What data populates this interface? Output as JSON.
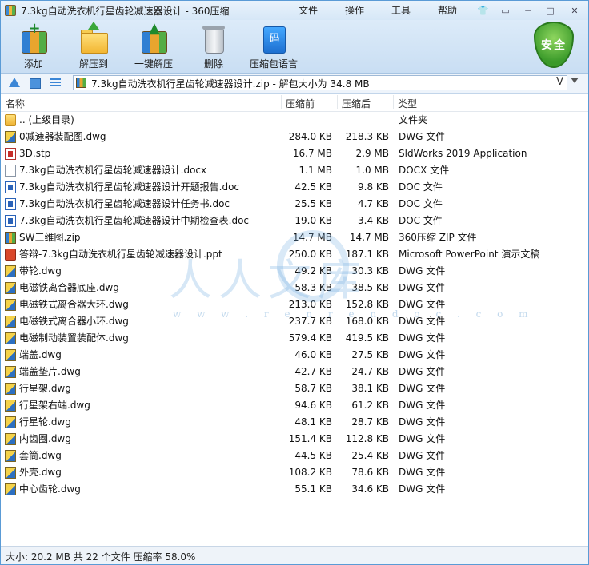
{
  "window": {
    "title": "7.3kg自动洗衣机行星齿轮减速器设计 - 360压缩",
    "controls": [
      "shirt-icon",
      "menu-icon",
      "minimize-icon",
      "maximize-icon",
      "close-icon"
    ]
  },
  "menu": [
    "文件",
    "操作",
    "工具",
    "帮助"
  ],
  "toolbar": {
    "add": "添加",
    "extract_to": "解压到",
    "one_click_extract": "一键解压",
    "delete": "删除",
    "language": "压缩包语言",
    "language_badge": "码",
    "security": "安全"
  },
  "address": {
    "text": "7.3kg自动洗衣机行星齿轮减速器设计.zip - 解包大小为 34.8 MB",
    "v_label": "V"
  },
  "columns": {
    "name": "名称",
    "original": "压缩前",
    "compressed": "压缩后",
    "type": "类型"
  },
  "files": [
    {
      "name": ".. (上级目录)",
      "size": "",
      "compressed": "",
      "type": "文件夹",
      "icon": "folder"
    },
    {
      "name": "0减速器装配图.dwg",
      "size": "284.0 KB",
      "compressed": "218.3 KB",
      "type": "DWG 文件",
      "icon": "dwg"
    },
    {
      "name": "3D.stp",
      "size": "16.7 MB",
      "compressed": "2.9 MB",
      "type": "SldWorks 2019 Application",
      "icon": "stp"
    },
    {
      "name": "7.3kg自动洗衣机行星齿轮减速器设计.docx",
      "size": "1.1 MB",
      "compressed": "1.0 MB",
      "type": "DOCX 文件",
      "icon": "docx"
    },
    {
      "name": "7.3kg自动洗衣机行星齿轮减速器设计开题报告.doc",
      "size": "42.5 KB",
      "compressed": "9.8 KB",
      "type": "DOC 文件",
      "icon": "doc"
    },
    {
      "name": "7.3kg自动洗衣机行星齿轮减速器设计任务书.doc",
      "size": "25.5 KB",
      "compressed": "4.7 KB",
      "type": "DOC 文件",
      "icon": "doc"
    },
    {
      "name": "7.3kg自动洗衣机行星齿轮减速器设计中期检查表.doc",
      "size": "19.0 KB",
      "compressed": "3.4 KB",
      "type": "DOC 文件",
      "icon": "doc"
    },
    {
      "name": "SW三维图.zip",
      "size": "14.7 MB",
      "compressed": "14.7 MB",
      "type": "360压缩 ZIP 文件",
      "icon": "zip"
    },
    {
      "name": "答辩-7.3kg自动洗衣机行星齿轮减速器设计.ppt",
      "size": "250.0 KB",
      "compressed": "187.1 KB",
      "type": "Microsoft PowerPoint 演示文稿",
      "icon": "ppt"
    },
    {
      "name": "带轮.dwg",
      "size": "49.2 KB",
      "compressed": "30.3 KB",
      "type": "DWG 文件",
      "icon": "dwg"
    },
    {
      "name": "电磁铁离合器底座.dwg",
      "size": "58.3 KB",
      "compressed": "38.5 KB",
      "type": "DWG 文件",
      "icon": "dwg"
    },
    {
      "name": "电磁铁式离合器大环.dwg",
      "size": "213.0 KB",
      "compressed": "152.8 KB",
      "type": "DWG 文件",
      "icon": "dwg"
    },
    {
      "name": "电磁铁式离合器小环.dwg",
      "size": "237.7 KB",
      "compressed": "168.0 KB",
      "type": "DWG 文件",
      "icon": "dwg"
    },
    {
      "name": "电磁制动装置装配体.dwg",
      "size": "579.4 KB",
      "compressed": "419.5 KB",
      "type": "DWG 文件",
      "icon": "dwg"
    },
    {
      "name": "端盖.dwg",
      "size": "46.0 KB",
      "compressed": "27.5 KB",
      "type": "DWG 文件",
      "icon": "dwg"
    },
    {
      "name": "端盖垫片.dwg",
      "size": "42.7 KB",
      "compressed": "24.7 KB",
      "type": "DWG 文件",
      "icon": "dwg"
    },
    {
      "name": "行星架.dwg",
      "size": "58.7 KB",
      "compressed": "38.1 KB",
      "type": "DWG 文件",
      "icon": "dwg"
    },
    {
      "name": "行星架右端.dwg",
      "size": "94.6 KB",
      "compressed": "61.2 KB",
      "type": "DWG 文件",
      "icon": "dwg"
    },
    {
      "name": "行星轮.dwg",
      "size": "48.1 KB",
      "compressed": "28.7 KB",
      "type": "DWG 文件",
      "icon": "dwg"
    },
    {
      "name": "内齿圈.dwg",
      "size": "151.4 KB",
      "compressed": "112.8 KB",
      "type": "DWG 文件",
      "icon": "dwg"
    },
    {
      "name": "套筒.dwg",
      "size": "44.5 KB",
      "compressed": "25.4 KB",
      "type": "DWG 文件",
      "icon": "dwg"
    },
    {
      "name": "外壳.dwg",
      "size": "108.2 KB",
      "compressed": "78.6 KB",
      "type": "DWG 文件",
      "icon": "dwg"
    },
    {
      "name": "中心齿轮.dwg",
      "size": "55.1 KB",
      "compressed": "34.6 KB",
      "type": "DWG 文件",
      "icon": "dwg"
    }
  ],
  "watermark": {
    "text": "人人文库",
    "url": "w w w . r e n r e n d o c . c o m"
  },
  "status": "大小: 20.2 MB 共 22 个文件 压缩率 58.0%"
}
